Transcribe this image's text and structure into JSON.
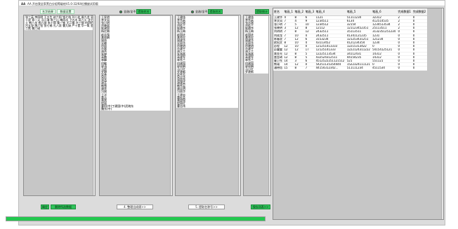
{
  "window": {
    "app_icon": "AA",
    "title": "AA 开启我全家黑白分组等级给V1.0-32/64位播放试用版"
  },
  "left_panel": {
    "tab_buttons": [
      "名字结果",
      "数据设置"
    ],
    "text": "张三英 李四明 王五生 赵六阳 钱七伟 孙八花 周九龙 吴十虎 郑一天 冯二海 陈三山 褚四水 卫五木 蒋六火 沈七土 韩八金 杨九银 朱十铜 秦一铁 尤二锡 许三钢 何四铝 吕五锌 施六铅 张七锡 孔八汞 曹九碳 严十氢 华一氧 金二氮 魏三硫",
    "bottom_buttons": [
      "确定",
      "删除所选数据"
    ]
  },
  "col2": {
    "radio_label": "全选/全不选",
    "radio_on": true,
    "button": "提取姓名",
    "lines": [
      "王家明",
      "李文凤",
      "张小明",
      "刘晓丽",
      "陈建国",
      "杨红梅",
      "赵志强",
      "黄丽娟",
      "周伟",
      "吴静",
      "徐斌",
      "孙磊",
      "胡杰",
      "朱婷",
      "高鹏",
      "林峰",
      "何敏",
      "郭涛",
      "马超",
      "罗琳",
      "梁勇",
      "宋佳",
      "郑浩",
      "谢芳",
      "韩雪",
      "唐亮",
      "冯刚",
      "于洋",
      "董洁",
      "萧然",
      "程丽",
      "曹阳(中)丁建国(中)武晓东",
      "魏东(中)"
    ],
    "bottom_button": "4. 整理出成绩>>"
  },
  "col3": {
    "radio_label": "全选/全不选",
    "radio_on": true,
    "button": "提取姓名",
    "lines": [
      "王建伟",
      "李秀英",
      "张志刚",
      "刘桂兰",
      "陈德华",
      "杨玉梅",
      "赵国庆",
      "黄秀珍",
      "周建华",
      "吴丽华",
      "徐晓明",
      "孙建平",
      "胡玉兰",
      "朱海燕",
      "高建军",
      "林秀兰",
      "何建国",
      "郭丽娟",
      "马小红",
      "罗建新",
      "梁秀芳",
      "宋志华",
      "郑丽萍",
      "谢建英",
      "韩秀云",
      "唐志明",
      "冯丽华",
      "于建忠",
      "董桂英",
      "萧国强",
      "程丽红",
      "曹志伟"
    ],
    "bottom_button": "5. 提取名称号>>"
  },
  "col4": {
    "button": "提取统计",
    "lines": [
      "王建伟",
      "李秀英",
      "张志刚",
      "刘桂兰",
      "陈德华",
      "杨玉梅",
      "赵国庆",
      "黄秀珍",
      "周建华",
      "吴丽华",
      "徐晓明",
      "孙建平",
      "胡玉兰",
      "朱海燕",
      "高建军",
      "林秀兰",
      "何建国",
      "郭丽娟",
      "马小红",
      "罗建新"
    ],
    "bottom_button": "保存详表>>"
  },
  "table": {
    "headers": [
      "姓名",
      "笔画_1",
      "笔画_2",
      "笔画_3",
      "笔画_4",
      "笔画_5",
      "笔画_6",
      "完成数据1",
      "完成数据2"
    ],
    "rows": [
      [
        "王建华",
        "4",
        "8",
        "6",
        "1121",
        "51111234",
        "32312",
        "2",
        "0"
      ],
      [
        "李文凤",
        "7",
        "4",
        "9",
        "1234511",
        "6134",
        "412514535",
        "2",
        "0"
      ],
      [
        "张小明",
        "7",
        "5",
        "10",
        "1234512",
        "32154",
        "1234513534",
        "2",
        "0"
      ],
      [
        "张晓明",
        "3",
        "12",
        "8",
        "12112",
        "121123452351",
        "25113511",
        "2",
        "0"
      ],
      [
        "刘明明",
        "7",
        "8",
        "12",
        "2432511",
        "35113511",
        "3132351251234",
        "0",
        "0"
      ],
      [
        "刘成龙",
        "7",
        "10",
        "4",
        "2432511",
        "41341121235",
        "1231",
        "0",
        "0"
      ],
      [
        "陈春虎",
        "7",
        "12",
        "6",
        "3153234",
        "121253431251",
        "121234",
        "0",
        "0"
      ],
      [
        "欧阳文",
        "8",
        "10",
        "4",
        "43113452",
        "4121234354",
        "1234",
        "0",
        "0"
      ],
      [
        "彭程",
        "12",
        "10",
        "0",
        "121251413333",
        "12215313422",
        "0",
        "0",
        "0"
      ],
      [
        "彭霍霆",
        "12",
        "12",
        "17",
        "12125141333",
        "1222124311222",
        "54154125121",
        "0",
        "0"
      ],
      [
        "薰金光",
        "12",
        "8",
        "5",
        "12225113534",
        "34112431",
        "14312",
        "0",
        "0"
      ],
      [
        "董金琦",
        "12",
        "8",
        "5",
        "432524312511",
        "44154235",
        "14312",
        "0",
        "0"
      ],
      [
        "曹卫东",
        "14",
        "3",
        "6",
        "4512522251121512",
        "521",
        "551121",
        "0",
        "0"
      ],
      [
        "熊瑞",
        "14",
        "12",
        "0",
        "54251135354444",
        "1522324111121",
        "0",
        "0",
        "0"
      ],
      [
        "潘德悟",
        "15",
        "8",
        "7",
        "44154312342...",
        "511111234",
        "4511534",
        "0",
        "0"
      ]
    ]
  },
  "progress": {
    "value": 1.0
  },
  "colors": {
    "accent": "#2fc35a",
    "panel": "#c6c6c6",
    "window": "#dcdcdc"
  }
}
